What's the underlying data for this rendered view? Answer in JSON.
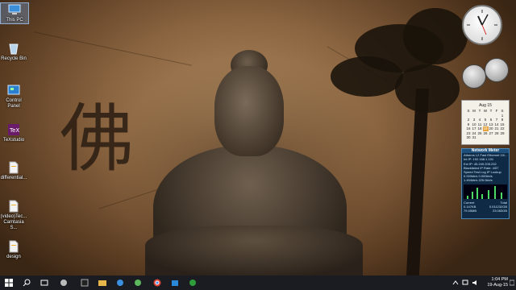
{
  "desktop": {
    "icons": [
      {
        "label": "This PC",
        "icon": "computer-icon"
      },
      {
        "label": "Recycle Bin",
        "icon": "recycle-bin-icon"
      },
      {
        "label": "Control Panel",
        "icon": "control-panel-icon"
      },
      {
        "label": "TeXstudio",
        "icon": "texstudio-icon"
      },
      {
        "label": "differential...",
        "icon": "document-icon"
      },
      {
        "label": "(video)Tec... Camtasia S...",
        "icon": "document-icon"
      },
      {
        "label": "design",
        "icon": "document-icon"
      }
    ],
    "wallpaper_character": "佛"
  },
  "gadgets": {
    "calendar": {
      "month_label": "Aug 15",
      "weekdays": [
        "S",
        "M",
        "T",
        "W",
        "T",
        "F",
        "S"
      ],
      "today": "19",
      "weeks": [
        [
          "",
          "",
          "",
          "",
          "",
          "",
          "1"
        ],
        [
          "2",
          "3",
          "4",
          "5",
          "6",
          "7",
          "8"
        ],
        [
          "9",
          "10",
          "11",
          "12",
          "13",
          "14",
          "15"
        ],
        [
          "16",
          "17",
          "18",
          "19",
          "20",
          "21",
          "22"
        ],
        [
          "23",
          "24",
          "25",
          "26",
          "27",
          "28",
          "29"
        ],
        [
          "30",
          "31",
          "",
          "",
          "",
          "",
          ""
        ]
      ]
    },
    "network_meter": {
      "title": "Network Meter",
      "line1": "Atheros L2 Fast Ethernet 10/...",
      "line2": "Int IP: 192.168.1.101",
      "line3": "Ext IP: 45.249.205.232",
      "line4": "Blacklisted IP Rate: 4/57",
      "line5": "Speed Test  Log  IP Lookup",
      "up": "0.000kb/s  0.000kb/s",
      "down": "1.494kb/s  225.0kb/s",
      "current_label": "Current",
      "total_label": "Total",
      "current_up": "0.147KB",
      "current_down": "79.45MB",
      "total_up": "0.011232GB",
      "total_down": "23.083GB"
    }
  },
  "taskbar": {
    "items": [
      "start-icon",
      "search-icon",
      "task-view-icon",
      "edge-icon",
      "terminal-icon",
      "folder-icon",
      "ie-icon",
      "browser-icon",
      "chrome-icon",
      "store-icon",
      "app-green-icon"
    ],
    "time": "1:04 PM",
    "date": "19-Aug-15"
  }
}
